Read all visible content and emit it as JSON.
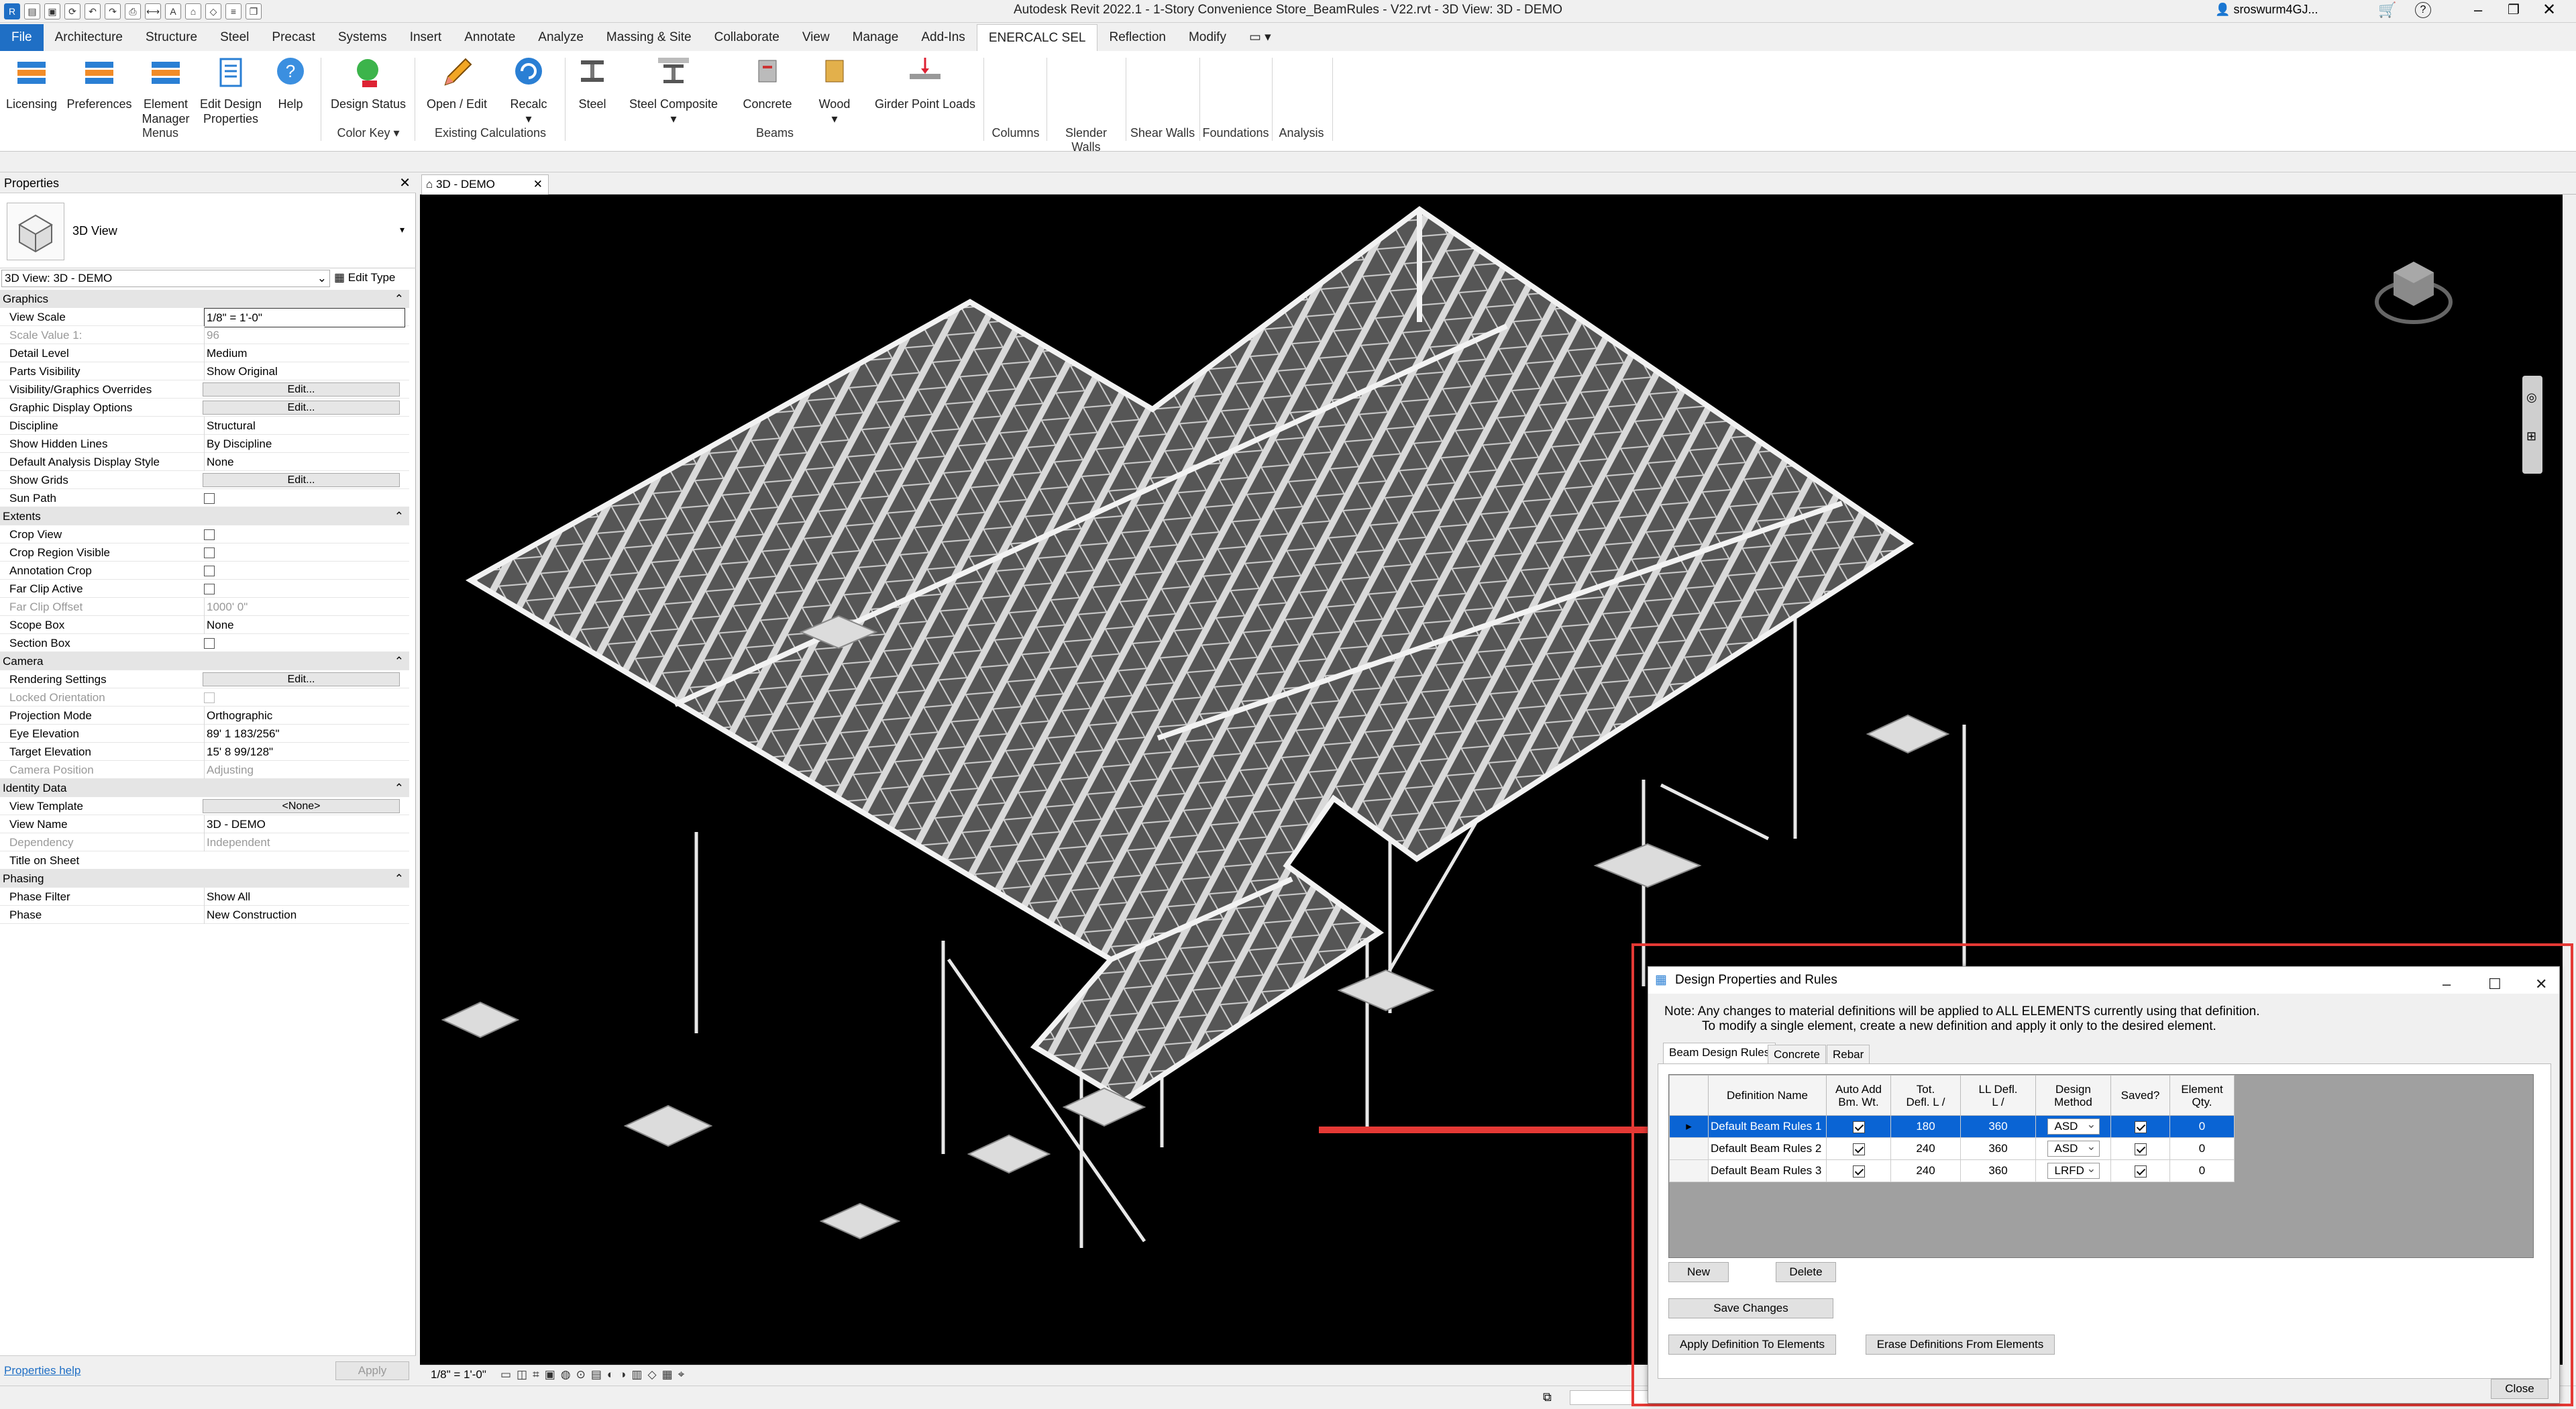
{
  "app": {
    "title": "Autodesk Revit 2022.1 - 1-Story Convenience Store_BeamRules - V22.rvt - 3D View: 3D - DEMO",
    "user": "sroswurm4GJ...",
    "help_glyph": "?"
  },
  "menu_tabs": [
    "File",
    "Architecture",
    "Structure",
    "Steel",
    "Precast",
    "Systems",
    "Insert",
    "Annotate",
    "Analyze",
    "Massing & Site",
    "Collaborate",
    "View",
    "Manage",
    "Add-Ins",
    "ENERCALC SEL",
    "Reflection",
    "Modify"
  ],
  "ribbon": {
    "buttons": {
      "licensing": "Licensing",
      "preferences": "Preferences",
      "element_manager_1": "Element",
      "element_manager_2": "Manager",
      "edit_design_1": "Edit Design",
      "edit_design_2": "Properties",
      "help": "Help",
      "design_status": "Design Status",
      "open_edit": "Open / Edit",
      "recalc": "Recalc",
      "steel": "Steel",
      "steel_composite": "Steel Composite",
      "concrete": "Concrete",
      "wood": "Wood",
      "girder_point_loads": "Girder Point Loads"
    },
    "panels": {
      "menus": "Menus",
      "color_key": "Color Key",
      "existing_calcs": "Existing Calculations",
      "beams": "Beams",
      "columns": "Columns",
      "slender_walls": "Slender Walls",
      "shear_walls": "Shear Walls",
      "foundations": "Foundations",
      "analysis": "Analysis"
    }
  },
  "properties": {
    "title": "Properties",
    "type_name": "3D View",
    "selector": "3D View: 3D - DEMO",
    "edit_type": "Edit Type",
    "edit_label": "Edit...",
    "help_link": "Properties help",
    "apply": "Apply",
    "sections": {
      "graphics": "Graphics",
      "extents": "Extents",
      "camera": "Camera",
      "identity": "Identity Data",
      "phasing": "Phasing"
    },
    "rows": {
      "view_scale": {
        "k": "View Scale",
        "v": "1/8\" = 1'-0\""
      },
      "scale_value": {
        "k": "Scale Value    1:",
        "v": "96"
      },
      "detail_level": {
        "k": "Detail Level",
        "v": "Medium"
      },
      "parts_visibility": {
        "k": "Parts Visibility",
        "v": "Show Original"
      },
      "vg_overrides": {
        "k": "Visibility/Graphics Overrides"
      },
      "graphic_display": {
        "k": "Graphic Display Options"
      },
      "discipline": {
        "k": "Discipline",
        "v": "Structural"
      },
      "hidden_lines": {
        "k": "Show Hidden Lines",
        "v": "By Discipline"
      },
      "analysis_style": {
        "k": "Default Analysis Display Style",
        "v": "None"
      },
      "show_grids": {
        "k": "Show Grids"
      },
      "sun_path": {
        "k": "Sun Path"
      },
      "crop_view": {
        "k": "Crop View"
      },
      "crop_region": {
        "k": "Crop Region Visible"
      },
      "annotation_crop": {
        "k": "Annotation Crop"
      },
      "far_clip_active": {
        "k": "Far Clip Active"
      },
      "far_clip_offset": {
        "k": "Far Clip Offset",
        "v": "1000'  0\""
      },
      "scope_box": {
        "k": "Scope Box",
        "v": "None"
      },
      "section_box": {
        "k": "Section Box"
      },
      "rendering": {
        "k": "Rendering Settings"
      },
      "locked_orientation": {
        "k": "Locked Orientation"
      },
      "projection": {
        "k": "Projection Mode",
        "v": "Orthographic"
      },
      "eye_elev": {
        "k": "Eye Elevation",
        "v": "89'  1 183/256\""
      },
      "target_elev": {
        "k": "Target Elevation",
        "v": "15'  8 99/128\""
      },
      "camera_pos": {
        "k": "Camera Position",
        "v": "Adjusting"
      },
      "view_template": {
        "k": "View Template",
        "v": "<None>"
      },
      "view_name": {
        "k": "View Name",
        "v": "3D - DEMO"
      },
      "dependency": {
        "k": "Dependency",
        "v": "Independent"
      },
      "title_on_sheet": {
        "k": "Title on Sheet",
        "v": ""
      },
      "phase_filter": {
        "k": "Phase Filter",
        "v": "Show All"
      },
      "phase": {
        "k": "Phase",
        "v": "New Construction"
      }
    }
  },
  "view": {
    "tab": "3D - DEMO",
    "scale_label": "1/8\" = 1'-0\""
  },
  "dialog": {
    "title": "Design Properties and Rules",
    "note1": "Note:  Any changes to material definitions will be applied to ALL ELEMENTS currently using that definition.",
    "note2": "To modify a single element, create a new definition and apply it only to the desired element.",
    "tabs": [
      "Beam Design Rules",
      "Concrete",
      "Rebar"
    ],
    "columns": {
      "name": "Definition Name",
      "auto_add_1": "Auto Add",
      "auto_add_2": "Bm. Wt.",
      "tot_defl_1": "Tot.",
      "tot_defl_2": "Defl. L /",
      "ll_defl_1": "LL Defl.",
      "ll_defl_2": "L /",
      "method_1": "Design",
      "method_2": "Method",
      "saved": "Saved?",
      "qty_1": "Element",
      "qty_2": "Qty."
    },
    "rows": [
      {
        "name": "Default Beam Rules 1",
        "tot": "180",
        "ll": "360",
        "method": "ASD",
        "qty": "0"
      },
      {
        "name": "Default Beam Rules 2",
        "tot": "240",
        "ll": "360",
        "method": "ASD",
        "qty": "0"
      },
      {
        "name": "Default Beam Rules 3",
        "tot": "240",
        "ll": "360",
        "method": "LRFD",
        "qty": "0"
      }
    ],
    "buttons": {
      "new": "New",
      "delete": "Delete",
      "save": "Save Changes",
      "apply": "Apply Definition To Elements",
      "erase": "Erase Definitions From Elements",
      "close": "Close"
    }
  },
  "colors": {
    "accent": "#1f6fc5",
    "selection": "#0a64d4",
    "highlight_frame": "#e53935",
    "arrow": "#e53935"
  }
}
